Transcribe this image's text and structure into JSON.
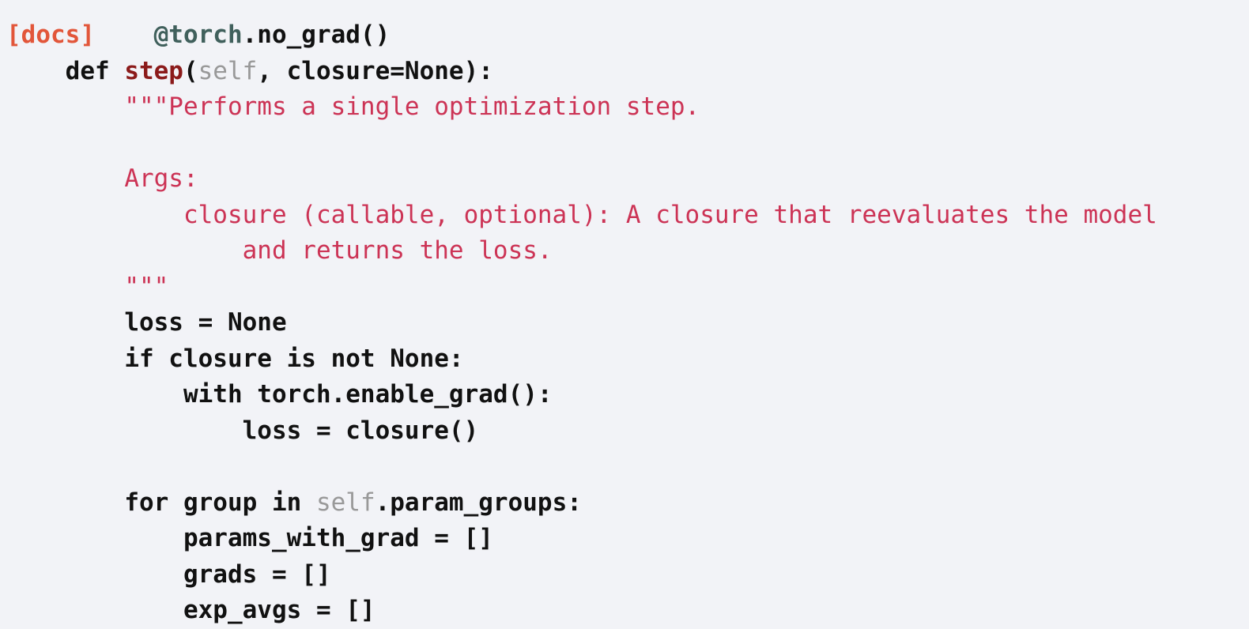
{
  "window": {
    "background_color": "#f2f3f7",
    "kind": "source-code-viewer"
  },
  "theme": {
    "background": "#f2f3f7",
    "code_color": "#111111",
    "string_color": "#cc3355",
    "docs_anchor_color": "#e2563a",
    "decorator_color": "#40605c",
    "function_name_color": "#8b1a1a",
    "self_param_color": "#999999"
  },
  "docs_anchor": {
    "label": "[docs]"
  },
  "code": {
    "language": "python",
    "lines": [
      {
        "id": "line-decorator",
        "tokens": [
          {
            "kind": "docs",
            "text": "[docs]"
          },
          {
            "kind": "blank",
            "text": "    "
          },
          {
            "kind": "decorator",
            "text": "@torch"
          },
          {
            "kind": "plain",
            "text": ".no_grad()"
          }
        ]
      },
      {
        "id": "line-def",
        "tokens": [
          {
            "kind": "blank",
            "text": "    "
          },
          {
            "kind": "keyword",
            "text": "def "
          },
          {
            "kind": "funcname",
            "text": "step"
          },
          {
            "kind": "plain",
            "text": "("
          },
          {
            "kind": "self",
            "text": "self"
          },
          {
            "kind": "plain",
            "text": ", closure=None):"
          }
        ]
      },
      {
        "id": "line-doc-open",
        "tokens": [
          {
            "kind": "blank",
            "text": "        "
          },
          {
            "kind": "string",
            "text": "\"\"\"Performs a single optimization step."
          }
        ]
      },
      {
        "id": "line-doc-blank1",
        "tokens": [
          {
            "kind": "blank",
            "text": " "
          }
        ]
      },
      {
        "id": "line-doc-args",
        "tokens": [
          {
            "kind": "blank",
            "text": "        "
          },
          {
            "kind": "string",
            "text": "Args:"
          }
        ]
      },
      {
        "id": "line-doc-closure",
        "tokens": [
          {
            "kind": "blank",
            "text": "            "
          },
          {
            "kind": "string",
            "text": "closure (callable, optional): A closure that reevaluates the model"
          }
        ]
      },
      {
        "id": "line-doc-returns",
        "tokens": [
          {
            "kind": "blank",
            "text": "                "
          },
          {
            "kind": "string",
            "text": "and returns the loss."
          }
        ]
      },
      {
        "id": "line-doc-close",
        "tokens": [
          {
            "kind": "blank",
            "text": "        "
          },
          {
            "kind": "string",
            "text": "\"\"\""
          }
        ]
      },
      {
        "id": "line-loss-none",
        "tokens": [
          {
            "kind": "blank",
            "text": "        "
          },
          {
            "kind": "plain",
            "text": "loss = None"
          }
        ]
      },
      {
        "id": "line-if-closure",
        "tokens": [
          {
            "kind": "blank",
            "text": "        "
          },
          {
            "kind": "plain",
            "text": "if closure is not None:"
          }
        ]
      },
      {
        "id": "line-with-enable-grad",
        "tokens": [
          {
            "kind": "blank",
            "text": "            "
          },
          {
            "kind": "plain",
            "text": "with torch.enable_grad():"
          }
        ]
      },
      {
        "id": "line-loss-closure",
        "tokens": [
          {
            "kind": "blank",
            "text": "                "
          },
          {
            "kind": "plain",
            "text": "loss = closure()"
          }
        ]
      },
      {
        "id": "line-blank2",
        "tokens": [
          {
            "kind": "blank",
            "text": " "
          }
        ]
      },
      {
        "id": "line-for-group",
        "tokens": [
          {
            "kind": "blank",
            "text": "        "
          },
          {
            "kind": "keyword",
            "text": "for group in "
          },
          {
            "kind": "self",
            "text": "self"
          },
          {
            "kind": "plain",
            "text": ".param_groups:"
          }
        ]
      },
      {
        "id": "line-params-with-grad",
        "tokens": [
          {
            "kind": "blank",
            "text": "            "
          },
          {
            "kind": "plain",
            "text": "params_with_grad = []"
          }
        ]
      },
      {
        "id": "line-grads",
        "tokens": [
          {
            "kind": "blank",
            "text": "            "
          },
          {
            "kind": "plain",
            "text": "grads = []"
          }
        ]
      },
      {
        "id": "line-exp-avgs",
        "tokens": [
          {
            "kind": "blank",
            "text": "            "
          },
          {
            "kind": "plain",
            "text": "exp_avgs = []"
          }
        ]
      }
    ]
  }
}
